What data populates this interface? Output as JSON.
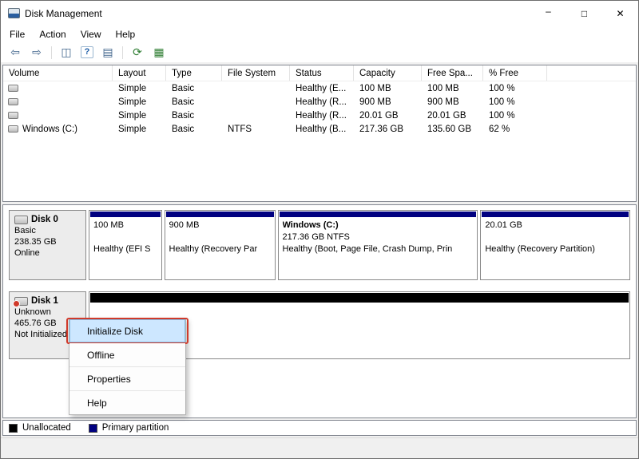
{
  "window": {
    "title": "Disk Management",
    "controls": {
      "minimize": "–",
      "maximize": "□",
      "close": "✕"
    }
  },
  "menu": {
    "items": [
      "File",
      "Action",
      "View",
      "Help"
    ]
  },
  "toolbar": {
    "icons": [
      {
        "name": "back-icon",
        "glyph": "⇦"
      },
      {
        "name": "forward-icon",
        "glyph": "⇨"
      },
      {
        "name": "console-tree-icon",
        "glyph": "◫"
      },
      {
        "name": "help-icon",
        "glyph": "?"
      },
      {
        "name": "action-pane-icon",
        "glyph": "▤"
      },
      {
        "name": "refresh-icon",
        "glyph": "⟳"
      },
      {
        "name": "properties-icon",
        "glyph": "▦"
      }
    ]
  },
  "volume_table": {
    "columns": [
      "Volume",
      "Layout",
      "Type",
      "File System",
      "Status",
      "Capacity",
      "Free Spa...",
      "% Free"
    ],
    "rows": [
      {
        "volume": "",
        "layout": "Simple",
        "type": "Basic",
        "fs": "",
        "status": "Healthy (E...",
        "capacity": "100 MB",
        "free": "100 MB",
        "pct": "100 %"
      },
      {
        "volume": "",
        "layout": "Simple",
        "type": "Basic",
        "fs": "",
        "status": "Healthy (R...",
        "capacity": "900 MB",
        "free": "900 MB",
        "pct": "100 %"
      },
      {
        "volume": "",
        "layout": "Simple",
        "type": "Basic",
        "fs": "",
        "status": "Healthy (R...",
        "capacity": "20.01 GB",
        "free": "20.01 GB",
        "pct": "100 %"
      },
      {
        "volume": "Windows (C:)",
        "layout": "Simple",
        "type": "Basic",
        "fs": "NTFS",
        "status": "Healthy (B...",
        "capacity": "217.36 GB",
        "free": "135.60 GB",
        "pct": "62 %"
      }
    ]
  },
  "disks": [
    {
      "name": "Disk 0",
      "type": "Basic",
      "size": "238.35 GB",
      "status": "Online",
      "partitions": [
        {
          "lines": [
            "100 MB",
            "",
            "Healthy (EFI S"
          ]
        },
        {
          "lines": [
            "900 MB",
            "",
            "Healthy (Recovery Par"
          ]
        },
        {
          "lines": [
            "Windows  (C:)",
            "217.36 GB NTFS",
            "Healthy (Boot, Page File, Crash Dump, Prin"
          ]
        },
        {
          "lines": [
            "20.01 GB",
            "",
            "Healthy (Recovery Partition)"
          ]
        }
      ]
    },
    {
      "name": "Disk 1",
      "type": "Unknown",
      "size": "465.76 GB",
      "status": "Not Initialized"
    }
  ],
  "context_menu": {
    "items": [
      "Initialize Disk",
      "Offline",
      "Properties",
      "Help"
    ],
    "highlighted": "Initialize Disk"
  },
  "legend": {
    "items": [
      {
        "label": "Unallocated",
        "color": "#000000"
      },
      {
        "label": "Primary partition",
        "color": "#000080"
      }
    ]
  },
  "colors": {
    "partition_stripe": "#000080",
    "unallocated": "#000000",
    "menu_highlight": "#cde7ff",
    "annotation_red": "#d03a2b"
  }
}
